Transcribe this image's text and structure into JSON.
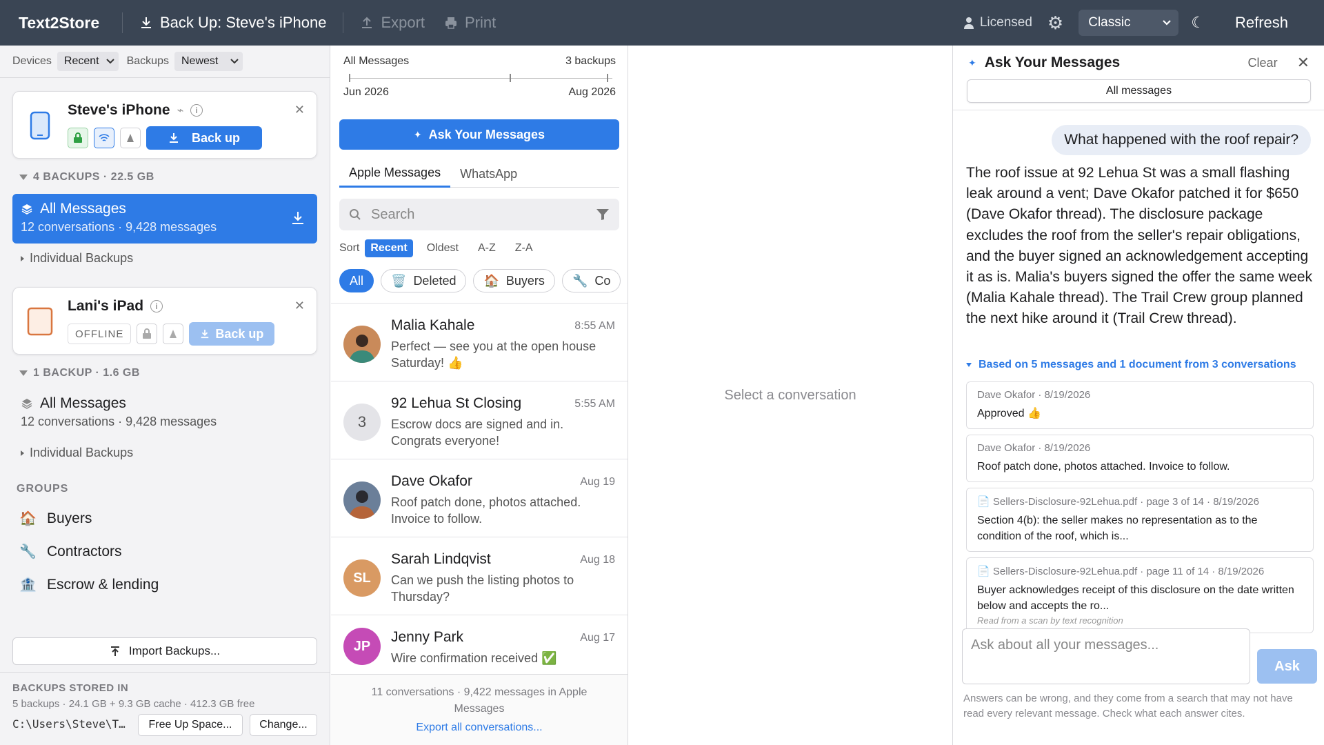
{
  "topbar": {
    "brand": "Text2Store",
    "backup_label": "Back Up: Steve's iPhone",
    "export_label": "Export",
    "print_label": "Print",
    "licensed_label": "Licensed",
    "theme_value": "Classic",
    "refresh_label": "Refresh"
  },
  "filters": {
    "devices_label": "Devices",
    "devices_value": "Recent",
    "backups_label": "Backups",
    "backups_value": "Newest"
  },
  "devices": [
    {
      "name": "Steve's iPhone",
      "status": "",
      "backup_button": "Back up",
      "section": "4 BACKUPS · 22.5 GB",
      "all_title": "All Messages",
      "all_sub": "12 conversations · 9,428 messages",
      "individual": "Individual Backups"
    },
    {
      "name": "Lani's iPad",
      "status": "OFFLINE",
      "backup_button": "Back up",
      "section": "1 BACKUP · 1.6 GB",
      "all_title": "All Messages",
      "all_sub": "12 conversations · 9,428 messages",
      "individual": "Individual Backups"
    }
  ],
  "groups": {
    "heading": "GROUPS",
    "items": [
      {
        "label": "Buyers",
        "icon": "house-emoji"
      },
      {
        "label": "Contractors",
        "icon": "wrench-icon"
      },
      {
        "label": "Escrow & lending",
        "icon": "bank-emoji"
      }
    ]
  },
  "storage": {
    "import_label": "Import Backups...",
    "heading": "BACKUPS STORED IN",
    "info": "5 backups · 24.1 GB + 9.3 GB cache · 412.3 GB free",
    "path": "C:\\Users\\Steve\\T…",
    "free_up_label": "Free Up Space...",
    "change_label": "Change..."
  },
  "timeline": {
    "title": "All Messages",
    "count": "3 backups",
    "start": "Jun 2026",
    "end": "Aug 2026"
  },
  "middle": {
    "ask_label": "Ask Your Messages",
    "tabs": [
      "Apple Messages",
      "WhatsApp"
    ],
    "search_placeholder": "Search",
    "sort_label": "Sort",
    "sort_options": [
      "Recent",
      "Oldest",
      "A-Z",
      "Z-A"
    ],
    "chips": [
      {
        "label": "All",
        "icon": ""
      },
      {
        "label": "Deleted",
        "icon": "trash-icon"
      },
      {
        "label": "Buyers",
        "icon": "house-emoji"
      },
      {
        "label": "Co",
        "icon": "wrench-icon"
      }
    ],
    "footer_info": "11 conversations · 9,422 messages in Apple Messages",
    "export_link": "Export all conversations..."
  },
  "conversations": [
    {
      "name": "Malia Kahale",
      "time": "8:55 AM",
      "preview": "Perfect — see you at the open house Saturday! 👍",
      "avatar": "",
      "avatar_color": "#c98a5a"
    },
    {
      "name": "92 Lehua St Closing",
      "time": "5:55 AM",
      "preview": "Escrow docs are signed and in. Congrats everyone!",
      "avatar": "3",
      "avatar_color": "#e4e4e8"
    },
    {
      "name": "Dave Okafor",
      "time": "Aug 19",
      "preview": "Roof patch done, photos attached. Invoice to follow.",
      "avatar": "",
      "avatar_color": "#6b7f99"
    },
    {
      "name": "Sarah Lindqvist",
      "time": "Aug 18",
      "preview": "Can we push the listing photos to Thursday?",
      "avatar": "SL",
      "avatar_color": "#d99a63"
    },
    {
      "name": "Jenny Park",
      "time": "Aug 17",
      "preview": "Wire confirmation received ✅",
      "avatar": "JP",
      "avatar_color": "#c54bb6"
    }
  ],
  "center": {
    "empty_text": "Select a conversation"
  },
  "ask_panel": {
    "title": "Ask Your Messages",
    "clear_label": "Clear",
    "scope": "All messages",
    "question": "What happened with the roof repair?",
    "answer": "The roof issue at 92 Lehua St was a small flashing leak around a vent; Dave Okafor patched it for $650 (Dave Okafor thread). The disclosure package excludes the roof from the seller's repair obligations, and the buyer signed an acknowledgement accepting it as is. Malia's buyers signed the offer the same week (Malia Kahale thread). The Trail Crew group planned the next hike around it (Trail Crew thread).",
    "based_on": "Based on 5 messages and 1 document from 3 conversations",
    "sources": [
      {
        "meta": "Dave Okafor · 8/19/2026",
        "body": "Approved 👍",
        "note": "",
        "doc": false
      },
      {
        "meta": "Dave Okafor · 8/19/2026",
        "body": "Roof patch done, photos attached. Invoice to follow.",
        "note": "",
        "doc": false
      },
      {
        "meta": "Sellers-Disclosure-92Lehua.pdf · page 3 of 14 · 8/19/2026",
        "body": "Section 4(b): the seller makes no representation as to the condition of the roof, which is...",
        "note": "",
        "doc": true
      },
      {
        "meta": "Sellers-Disclosure-92Lehua.pdf · page 11 of 14 · 8/19/2026",
        "body": "Buyer acknowledges receipt of this disclosure on the date written below and accepts the ro...",
        "note": "Read from a scan by text recognition",
        "doc": true
      }
    ],
    "input_placeholder": "Ask about all your messages...",
    "ask_button": "Ask",
    "disclaimer": "Answers can be wrong, and they come from a search that may not have read every relevant message. Check what each answer cites."
  }
}
